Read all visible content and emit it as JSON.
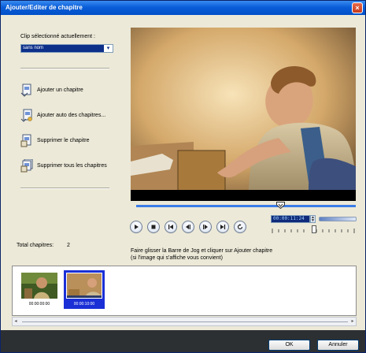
{
  "window": {
    "title": "Ajouter/Editer de chapitre",
    "close_glyph": "×"
  },
  "left": {
    "clip_label": "Clip sélectionné actuellement :",
    "clip_value": "sans nom",
    "dropdown_glyph": "▾",
    "actions": [
      {
        "label": "Ajouter un chapitre",
        "icon": "add-chapter-icon"
      },
      {
        "label": "Ajouter auto des chapitres...",
        "icon": "auto-add-chapters-icon"
      },
      {
        "label": "Supprimer le chapitre",
        "icon": "delete-chapter-icon"
      },
      {
        "label": "Supprimer tous les chapitres",
        "icon": "delete-all-chapters-icon"
      }
    ],
    "total_label": "Total chapitres:",
    "total_value": "2"
  },
  "player": {
    "timecode": "00:00:11:24",
    "spin_up": "▲",
    "spin_down": "▼",
    "buttons": [
      "play",
      "stop",
      "previous-chapter",
      "step-back",
      "step-forward",
      "next-chapter",
      "repeat"
    ]
  },
  "hint": {
    "line1": "Faire glisser la Barre de Jog et cliquer sur Ajouter chapitre",
    "line2": "(si l'image qui s'affiche vous convient)"
  },
  "chapters": [
    {
      "timecode": "00:00:00:00",
      "selected": false
    },
    {
      "timecode": "00:00:10:00",
      "selected": true
    }
  ],
  "scroll": {
    "left_glyph": "◂",
    "right_glyph": "▸"
  },
  "footer": {
    "ok_label": "OK",
    "cancel_label": "Annuler"
  },
  "colors": {
    "titlebar": "#0a5ed8",
    "jog": "#3b7be6",
    "selection": "#1a2fd6",
    "footer": "#2d3033"
  }
}
